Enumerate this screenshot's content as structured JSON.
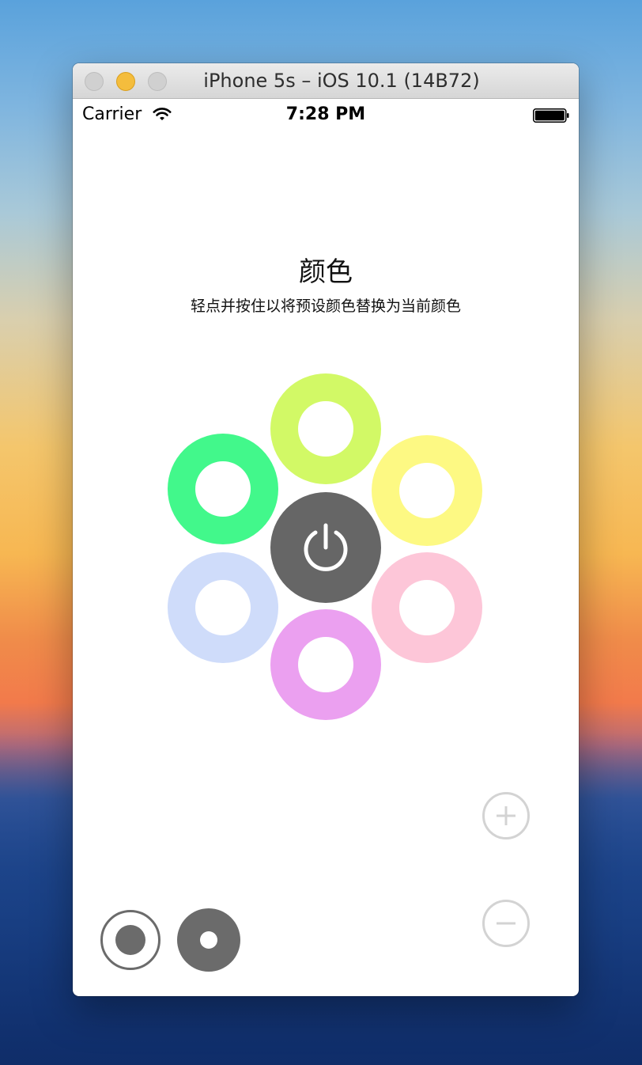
{
  "window": {
    "title": "iPhone 5s – iOS 10.1 (14B72)"
  },
  "statusbar": {
    "carrier": "Carrier",
    "time": "7:28 PM",
    "wifi_icon": "wifi-icon",
    "battery_icon": "battery-icon"
  },
  "main": {
    "heading": "颜色",
    "subheading": "轻点并按住以将预设颜色替换为当前颜色"
  },
  "color_presets": [
    {
      "name": "lime",
      "color": "#d2f966"
    },
    {
      "name": "green",
      "color": "#42f88b"
    },
    {
      "name": "yellow",
      "color": "#fdf983"
    },
    {
      "name": "light-blue",
      "color": "#cfdcfa"
    },
    {
      "name": "pink",
      "color": "#fdc6d8"
    },
    {
      "name": "violet",
      "color": "#eba0f0"
    }
  ],
  "power_button": {
    "icon": "power-icon",
    "color": "#666666"
  },
  "controls": {
    "plus_icon": "plus-icon",
    "minus_icon": "minus-icon",
    "control_color": "#d3d3d3"
  },
  "modes": {
    "outline_icon": "ring-dot-icon",
    "filled_icon": "filled-dot-icon",
    "mode_color": "#6b6b6b"
  }
}
